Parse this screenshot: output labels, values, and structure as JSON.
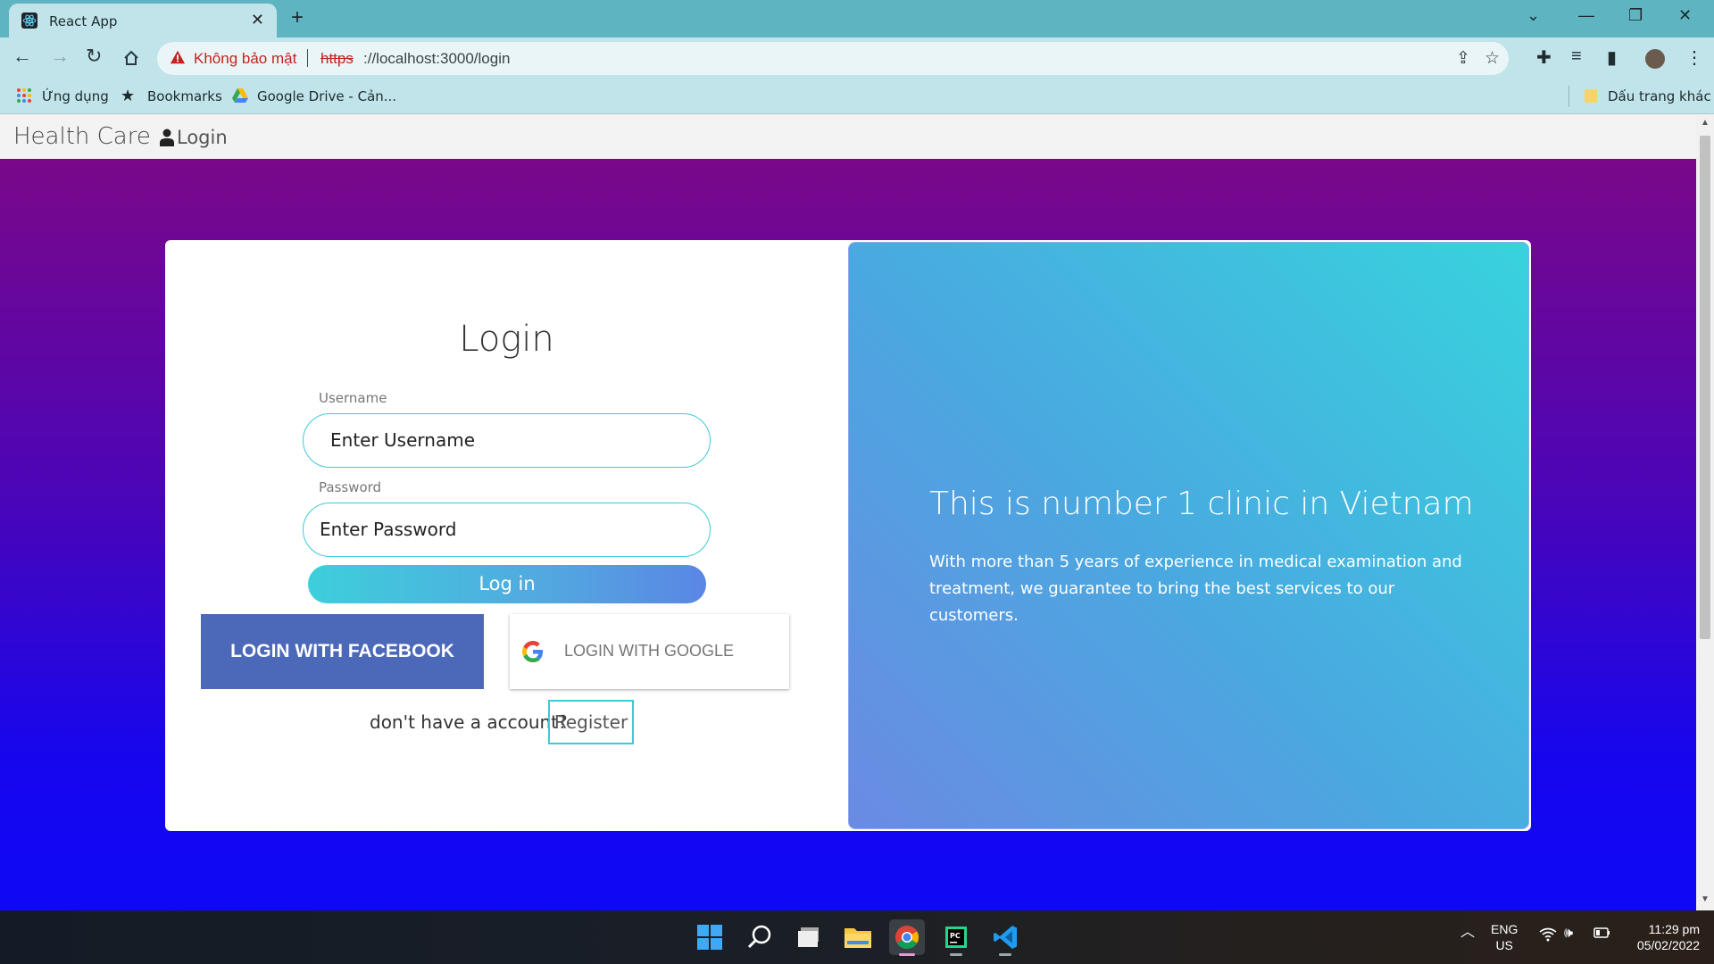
{
  "browser": {
    "tab_title": "React App",
    "security_label": "Không bảo mật",
    "url_scheme": "https",
    "url_rest": "://localhost:3000/login",
    "bookmarks": {
      "apps": "Ứng dụng",
      "bookmarks": "Bookmarks",
      "drive": "Google Drive - Cản...",
      "other": "Dấu trang khác"
    }
  },
  "navbar": {
    "brand": "Health Care",
    "login_link": "Login"
  },
  "login_form": {
    "title": "Login",
    "username_label": "Username",
    "username_placeholder": "Enter Username",
    "password_label": "Password",
    "password_placeholder": "Enter Password",
    "submit_label": "Log in",
    "facebook_label": "LOGIN WITH FACEBOOK",
    "google_label": "LOGIN WITH GOOGLE",
    "register_prompt": "don't have a account?",
    "register_label": "Register"
  },
  "promo": {
    "title": "This is number 1 clinic in Vietnam",
    "text": "With more than 5 years of experience in medical examination and treatment, we guarantee to bring the best services to our customers."
  },
  "taskbar": {
    "lang_line1": "ENG",
    "lang_line2": "US",
    "time": "11:29 pm",
    "date": "05/02/2022"
  },
  "colors": {
    "accent_teal": "#3ecad6",
    "facebook_blue": "#4c68b8",
    "page_gradient_top": "#7a0889",
    "page_gradient_bottom": "#0f08f5",
    "security_red": "#c5221f"
  }
}
